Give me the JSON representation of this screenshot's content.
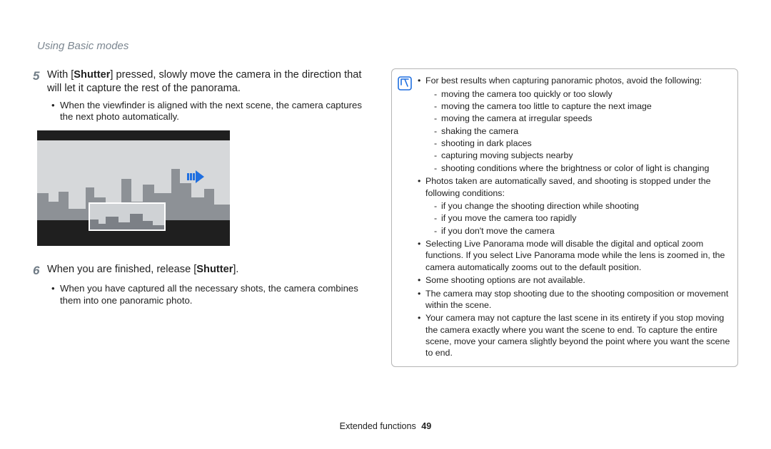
{
  "section_title": "Using Basic modes",
  "steps": [
    {
      "num": "5",
      "text_parts": [
        "With [",
        "Shutter",
        "] pressed, slowly move the camera in the direction that will let it capture the rest of the panorama."
      ],
      "sub": [
        "When the viewfinder is aligned with the next scene, the camera captures the next photo automatically."
      ]
    },
    {
      "num": "6",
      "text_parts": [
        "When you are finished, release [",
        "Shutter",
        "]."
      ],
      "sub": [
        "When you have captured all the necessary shots, the camera combines them into one panoramic photo."
      ]
    }
  ],
  "note": {
    "bullets": [
      {
        "text": "For best results when capturing panoramic photos, avoid the following:",
        "sub": [
          "moving the camera too quickly or too slowly",
          "moving the camera too little to capture the next image",
          "moving the camera at irregular speeds",
          "shaking the camera",
          "shooting in dark places",
          "capturing moving subjects nearby",
          "shooting conditions where the brightness or color of light is changing"
        ]
      },
      {
        "text": "Photos taken are automatically saved, and shooting is stopped under the following conditions:",
        "sub": [
          "if you change the shooting direction while shooting",
          "if you move the camera too rapidly",
          "if you don't move the camera"
        ]
      },
      {
        "text": "Selecting Live Panorama mode will disable the digital and optical zoom functions. If you select Live Panorama mode while the lens is zoomed in, the camera automatically zooms out to the default position."
      },
      {
        "text": "Some shooting options are not available."
      },
      {
        "text": "The camera may stop shooting due to the shooting composition or movement within the scene."
      },
      {
        "text": "Your camera may not capture the last scene in its entirety if you stop moving the camera exactly where you want the scene to end. To capture the entire scene, move your camera slightly beyond the point where you want the scene to end."
      }
    ]
  },
  "footer": {
    "label": "Extended functions",
    "page": "49"
  }
}
